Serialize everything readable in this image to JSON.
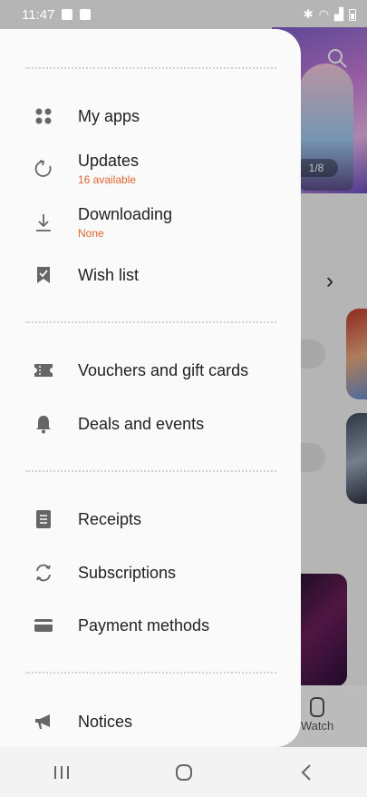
{
  "status_bar": {
    "time": "11:47"
  },
  "background": {
    "pager": "1/8",
    "watch_label": "Watch"
  },
  "drawer": {
    "items": [
      {
        "label": "My apps",
        "sub": ""
      },
      {
        "label": "Updates",
        "sub": "16 available"
      },
      {
        "label": "Downloading",
        "sub": "None"
      },
      {
        "label": "Wish list",
        "sub": ""
      },
      {
        "label": "Vouchers and gift cards",
        "sub": ""
      },
      {
        "label": "Deals and events",
        "sub": ""
      },
      {
        "label": "Receipts",
        "sub": ""
      },
      {
        "label": "Subscriptions",
        "sub": ""
      },
      {
        "label": "Payment methods",
        "sub": ""
      },
      {
        "label": "Notices",
        "sub": ""
      }
    ]
  },
  "icons": {
    "my_apps": "grid-icon",
    "updates": "refresh-icon",
    "downloading": "download-icon",
    "wish_list": "bookmark-icon",
    "vouchers": "ticket-icon",
    "deals": "bell-icon",
    "receipts": "receipt-icon",
    "subscriptions": "sync-icon",
    "payment": "card-icon",
    "notices": "megaphone-icon"
  },
  "colors": {
    "accent_sub": "#e0642e",
    "icon": "#666666"
  }
}
